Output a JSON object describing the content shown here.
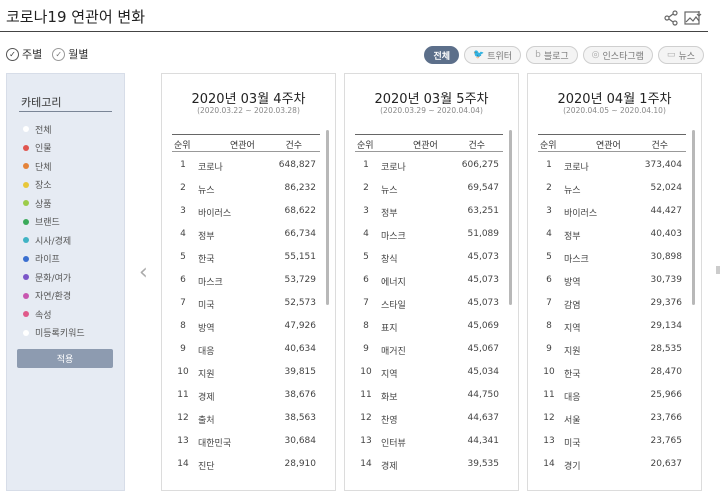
{
  "header": {
    "title": "코로나19 연관어 변화",
    "share_icon": "share-icon",
    "image_icon": "image-download-icon"
  },
  "period": {
    "weekly": "주별",
    "monthly": "월별",
    "selected": "weekly"
  },
  "sources": [
    {
      "label": "전체",
      "icon": "",
      "active": true
    },
    {
      "label": "트위터",
      "icon": "🐦",
      "active": false
    },
    {
      "label": "블로그",
      "icon": "b",
      "active": false
    },
    {
      "label": "인스타그램",
      "icon": "◎",
      "active": false
    },
    {
      "label": "뉴스",
      "icon": "▭",
      "active": false
    }
  ],
  "sidebar": {
    "title": "카테고리",
    "items": [
      {
        "label": "전체",
        "color": "#ffffff"
      },
      {
        "label": "인물",
        "color": "#e0554f"
      },
      {
        "label": "단체",
        "color": "#e4833a"
      },
      {
        "label": "장소",
        "color": "#e8c73a"
      },
      {
        "label": "상품",
        "color": "#9ccc4a"
      },
      {
        "label": "브랜드",
        "color": "#3aaa5a"
      },
      {
        "label": "시사/경제",
        "color": "#40b3c4"
      },
      {
        "label": "라이프",
        "color": "#3a6fd0"
      },
      {
        "label": "문화/여가",
        "color": "#7b56c8"
      },
      {
        "label": "자연/환경",
        "color": "#c857b0"
      },
      {
        "label": "속성",
        "color": "#e05a8a"
      },
      {
        "label": "미등록키워드",
        "color": "#ffffff"
      }
    ],
    "apply_label": "적용"
  },
  "table_headers": {
    "rank": "순위",
    "word": "연관어",
    "count": "건수"
  },
  "panels": [
    {
      "week": "2020년 03월 4주차",
      "range": "(2020.03.22 ~ 2020.03.28)",
      "rows": [
        {
          "rank": "1",
          "word": "코로나",
          "count": "648,827"
        },
        {
          "rank": "2",
          "word": "뉴스",
          "count": "86,232"
        },
        {
          "rank": "3",
          "word": "바이러스",
          "count": "68,622"
        },
        {
          "rank": "4",
          "word": "정부",
          "count": "66,734"
        },
        {
          "rank": "5",
          "word": "한국",
          "count": "55,151"
        },
        {
          "rank": "6",
          "word": "마스크",
          "count": "53,729"
        },
        {
          "rank": "7",
          "word": "미국",
          "count": "52,573"
        },
        {
          "rank": "8",
          "word": "방역",
          "count": "47,926"
        },
        {
          "rank": "9",
          "word": "대응",
          "count": "40,634"
        },
        {
          "rank": "10",
          "word": "지원",
          "count": "39,815"
        },
        {
          "rank": "11",
          "word": "경제",
          "count": "38,676"
        },
        {
          "rank": "12",
          "word": "출처",
          "count": "38,563"
        },
        {
          "rank": "13",
          "word": "대한민국",
          "count": "30,684"
        },
        {
          "rank": "14",
          "word": "진단",
          "count": "28,910"
        }
      ]
    },
    {
      "week": "2020년 03월 5주차",
      "range": "(2020.03.29 ~ 2020.04.04)",
      "rows": [
        {
          "rank": "1",
          "word": "코로나",
          "count": "606,275"
        },
        {
          "rank": "2",
          "word": "뉴스",
          "count": "69,547"
        },
        {
          "rank": "3",
          "word": "정부",
          "count": "63,251"
        },
        {
          "rank": "4",
          "word": "마스크",
          "count": "51,089"
        },
        {
          "rank": "5",
          "word": "창식",
          "count": "45,073"
        },
        {
          "rank": "6",
          "word": "에너지",
          "count": "45,073"
        },
        {
          "rank": "7",
          "word": "스타일",
          "count": "45,073"
        },
        {
          "rank": "8",
          "word": "표지",
          "count": "45,069"
        },
        {
          "rank": "9",
          "word": "매거진",
          "count": "45,067"
        },
        {
          "rank": "10",
          "word": "지역",
          "count": "45,034"
        },
        {
          "rank": "11",
          "word": "화보",
          "count": "44,750"
        },
        {
          "rank": "12",
          "word": "찬영",
          "count": "44,637"
        },
        {
          "rank": "13",
          "word": "인터뷰",
          "count": "44,341"
        },
        {
          "rank": "14",
          "word": "경제",
          "count": "39,535"
        }
      ]
    },
    {
      "week": "2020년 04월 1주차",
      "range": "(2020.04.05 ~ 2020.04.10)",
      "rows": [
        {
          "rank": "1",
          "word": "코로나",
          "count": "373,404"
        },
        {
          "rank": "2",
          "word": "뉴스",
          "count": "52,024"
        },
        {
          "rank": "3",
          "word": "바이러스",
          "count": "44,427"
        },
        {
          "rank": "4",
          "word": "정부",
          "count": "40,403"
        },
        {
          "rank": "5",
          "word": "마스크",
          "count": "30,898"
        },
        {
          "rank": "6",
          "word": "방역",
          "count": "30,739"
        },
        {
          "rank": "7",
          "word": "감염",
          "count": "29,376"
        },
        {
          "rank": "8",
          "word": "지역",
          "count": "29,134"
        },
        {
          "rank": "9",
          "word": "지원",
          "count": "28,535"
        },
        {
          "rank": "10",
          "word": "한국",
          "count": "28,470"
        },
        {
          "rank": "11",
          "word": "대응",
          "count": "25,966"
        },
        {
          "rank": "12",
          "word": "서울",
          "count": "23,766"
        },
        {
          "rank": "13",
          "word": "미국",
          "count": "23,765"
        },
        {
          "rank": "14",
          "word": "경기",
          "count": "20,637"
        }
      ]
    }
  ]
}
